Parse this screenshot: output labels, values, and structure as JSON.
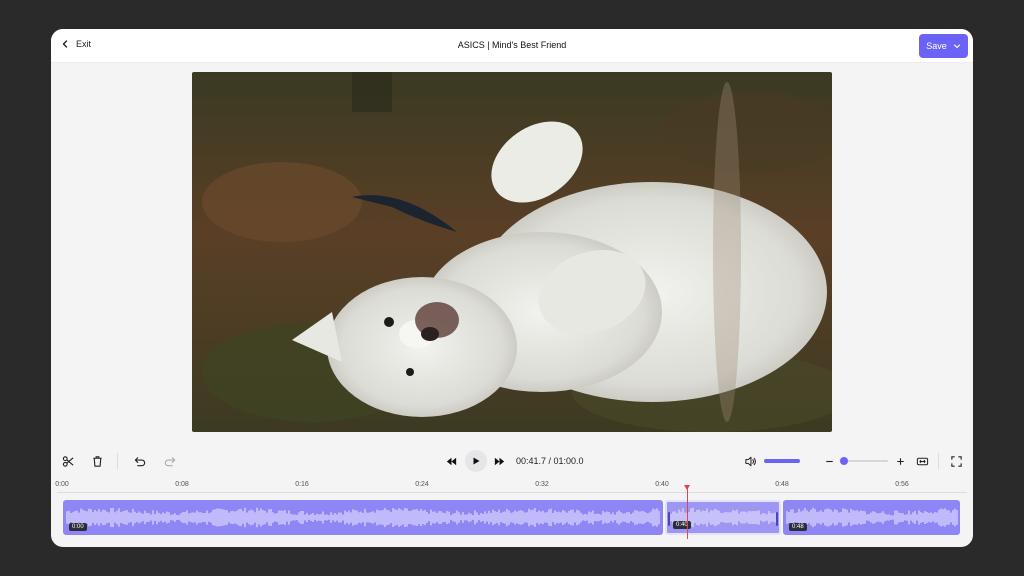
{
  "header": {
    "exit_label": "Exit",
    "title": "ASICS | Mind's Best Friend",
    "save_label": "Save"
  },
  "player": {
    "time_display": "00:41.7 / 01:00.0",
    "volume_level": 1.0,
    "zoom_level": 0.1
  },
  "ruler": {
    "ticks": [
      "0:00",
      "0:08",
      "0:16",
      "0:24",
      "0:32",
      "0:40",
      "0:48",
      "0:56"
    ]
  },
  "timeline": {
    "clips": [
      {
        "start_label": "0:00"
      },
      {
        "start_label": "0:40"
      },
      {
        "start_label": "0:48"
      }
    ]
  },
  "colors": {
    "accent": "#6b63f6",
    "waveform": "#8f86f6",
    "playhead": "#e0474c",
    "background": "#2a2a2a"
  },
  "icons": [
    "back-chevron-icon",
    "chevron-down-icon",
    "scissors-icon",
    "trash-icon",
    "undo-icon",
    "redo-icon",
    "rewind-icon",
    "play-icon",
    "fast-forward-icon",
    "volume-icon",
    "zoom-out-icon",
    "zoom-in-icon",
    "fit-icon",
    "fullscreen-icon"
  ]
}
